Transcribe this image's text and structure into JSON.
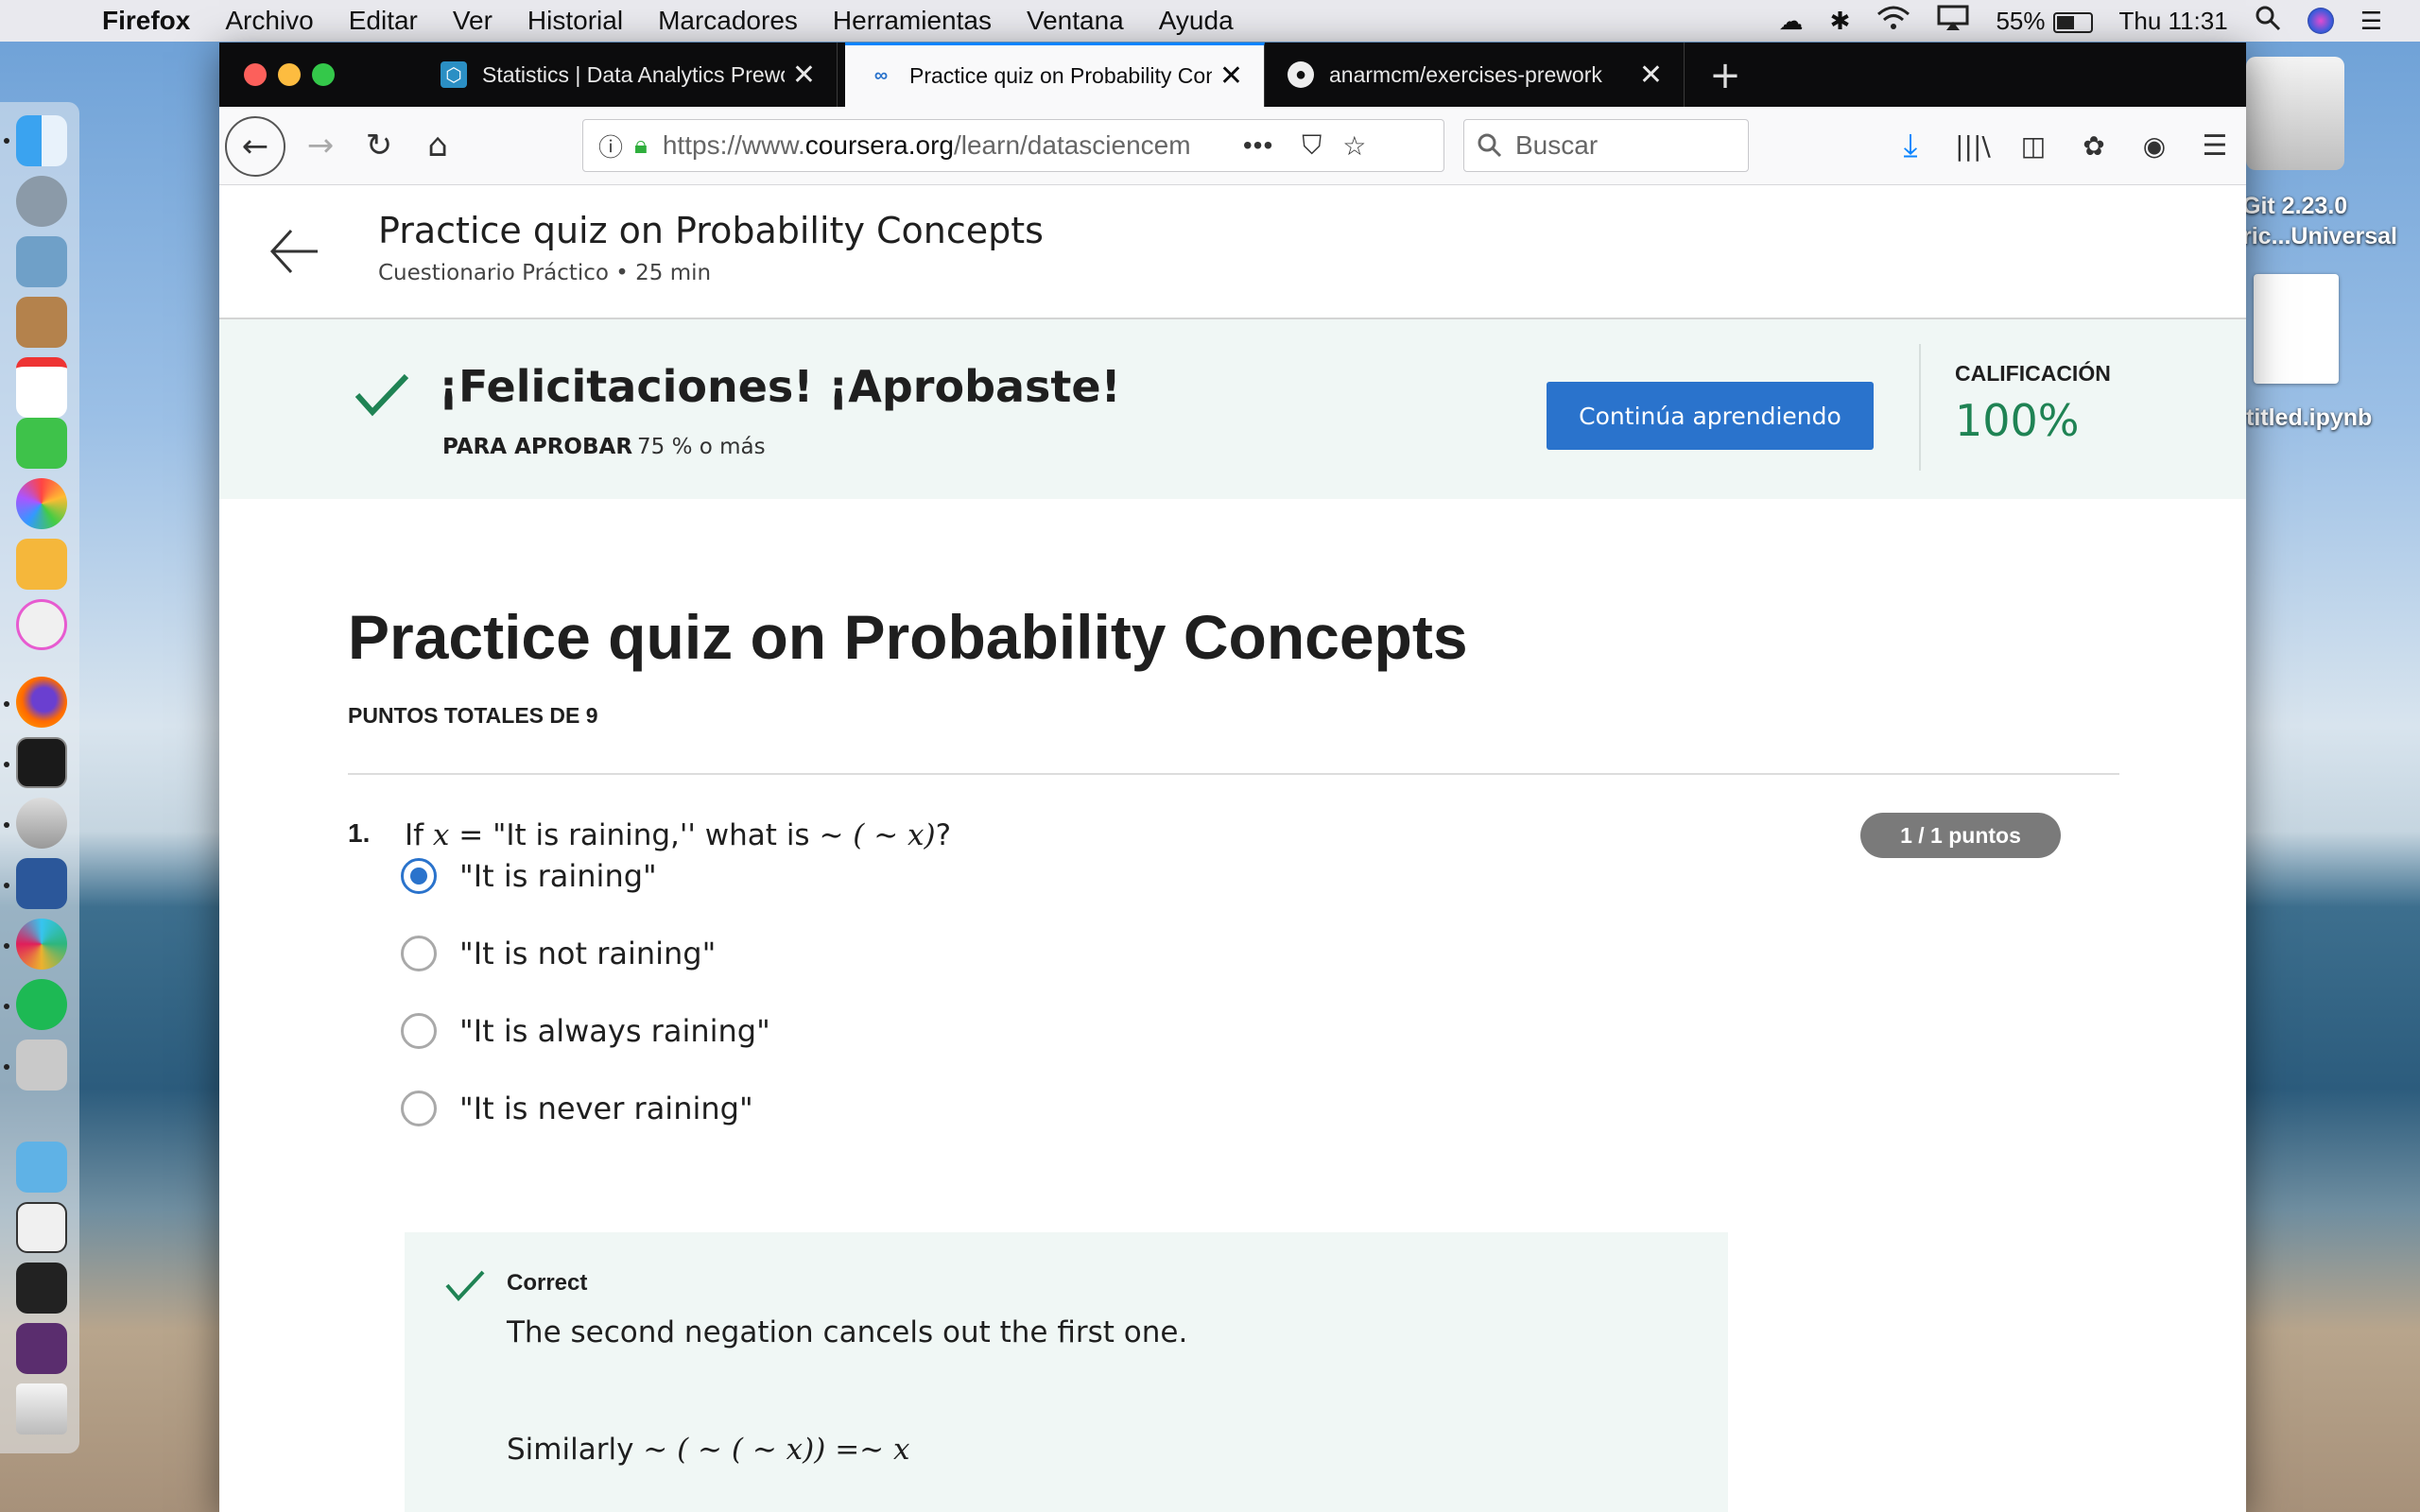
{
  "menubar": {
    "app": "Firefox",
    "menus": [
      "Archivo",
      "Editar",
      "Ver",
      "Historial",
      "Marcadores",
      "Herramientas",
      "Ventana",
      "Ayuda"
    ],
    "battery": "55%",
    "clock": "Thu 11:31"
  },
  "desktop": {
    "drive_label_1": "Git 2.23.0",
    "drive_label_2": "ric...Universal",
    "file_label": "titled.ipynb"
  },
  "tabs": [
    {
      "title": "Statistics | Data Analytics Prework"
    },
    {
      "title": "Practice quiz on Probability Concepts"
    },
    {
      "title": "anarmcm/exercises-prework"
    }
  ],
  "navbar": {
    "url_prefix": "https://www.",
    "url_domain": "coursera.org",
    "url_path": "/learn/datasciencem",
    "search_placeholder": "Buscar",
    "more": "•••"
  },
  "header": {
    "title": "Practice quiz on Probability Concepts",
    "subtitle": "Cuestionario Práctico • 25 min"
  },
  "result": {
    "message": "¡Felicitaciones! ¡Aprobaste!",
    "to_pass_label": "PARA APROBAR",
    "to_pass_value": "75 % o más",
    "continue_label": "Continúa aprendiendo",
    "grade_label": "CALIFICACIÓN",
    "grade_value": "100%"
  },
  "quiz": {
    "title": "Practice quiz on Probability Concepts",
    "total_points": "PUNTOS TOTALES DE 9",
    "question": {
      "number": "1.",
      "prefix": "If ",
      "var": "x",
      "middle": " = \"It is raining,'' what is ",
      "expr": "∼ ( ∼ x)",
      "suffix": "?",
      "points": "1 / 1 puntos",
      "options": [
        {
          "label": "\"It is raining\"",
          "selected": true
        },
        {
          "label": "\"It is not raining\"",
          "selected": false
        },
        {
          "label": "\"It is always raining\"",
          "selected": false
        },
        {
          "label": "\"It is never raining\"",
          "selected": false
        }
      ],
      "feedback": {
        "status": "Correct",
        "text": "The second negation cancels out the first one.",
        "similarly": "Similarly ",
        "expr": "∼ ( ∼ ( ∼ x)) =∼ x"
      }
    }
  },
  "colors": {
    "accent": "#2a73cc",
    "success": "#1f8354",
    "success_bg": "#f0f7f5"
  }
}
